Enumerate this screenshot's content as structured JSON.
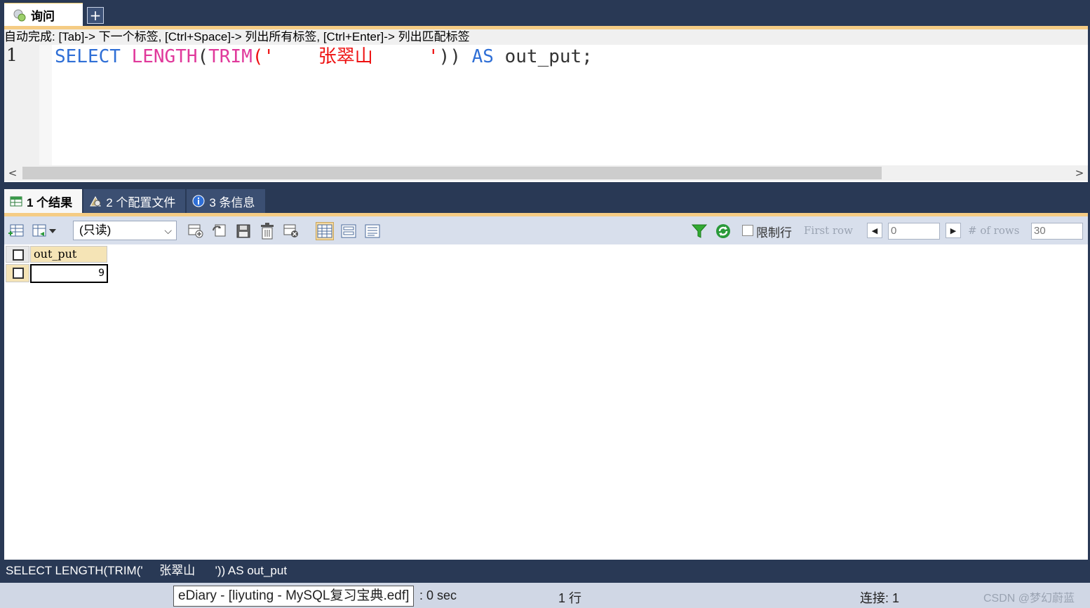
{
  "tabs": {
    "query_tab_label": "询问",
    "add_tab_label": "+"
  },
  "editor": {
    "hint": "自动完成: [Tab]-> 下一个标签, [Ctrl+Space]-> 列出所有标签, [Ctrl+Enter]-> 列出匹配标签",
    "line_number": "1",
    "code": {
      "kw_select": "SELECT",
      "fn_length": "LENGTH",
      "paren_open": "(",
      "fn_trim": "TRIM",
      "str_open": "('",
      "str_name": "张翠山",
      "str_close": "'",
      "paren_close": "))",
      "kw_as": "AS",
      "alias": "out_put;"
    },
    "scroll_left": "<",
    "scroll_right": ">"
  },
  "result_tabs": [
    {
      "label": "1 个结果"
    },
    {
      "label": "2 个配置文件"
    },
    {
      "label": "3 条信息"
    }
  ],
  "toolbar": {
    "mode_select": "(只读)",
    "limit_rows_label": "限制行",
    "first_row_label": "First row",
    "first_row_value": "0",
    "num_rows_label": "# of rows",
    "num_rows_value": "30"
  },
  "grid": {
    "column": "out_put",
    "rows": [
      {
        "out_put": "9"
      }
    ]
  },
  "bottom_query": "SELECT LENGTH(TRIM('     张翠山      ')) AS out_put",
  "status": {
    "tooltip": "eDiary - [liyuting - MySQL复习宝典.edf]",
    "exec_time": ": 0 sec",
    "rows": "1 行",
    "connection": "连接: 1",
    "watermark": "CSDN @梦幻蔚蓝"
  },
  "colors": {
    "frame": "#293955",
    "accent_gold": "#f5cc84",
    "keyword": "#2f6fd6",
    "function": "#e0399b",
    "string": "#e11111"
  }
}
